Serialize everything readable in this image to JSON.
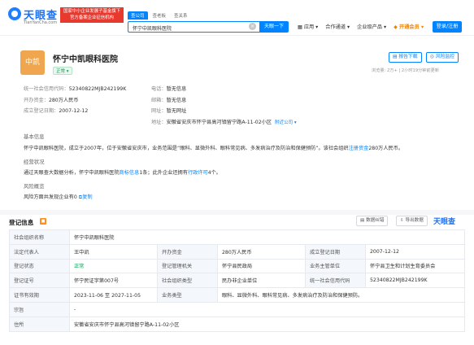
{
  "header": {
    "logo_cn": "天眼查",
    "logo_en": "TianYanCha.com",
    "promo_lines": [
      "国家中小企业发展子基金旗下",
      "官方备案企业征信机构"
    ],
    "search_tabs": [
      "查公司",
      "查老板",
      "查关系"
    ],
    "search_value": "怀宁中凯眼科医院",
    "search_button": "天眼一下",
    "nav": [
      "应用",
      "合作通道",
      "企业级产品",
      "开通会员"
    ],
    "login": "登录/注册"
  },
  "company": {
    "avatar": "中凯",
    "name": "怀宁中凯眼科医院",
    "status": "正常",
    "report_btn": "报告下载",
    "risk_btn": "风险监控",
    "meta": "浏览量: 2万+  |  2小时19分钟前更新",
    "fields_left": [
      {
        "k": "统一社会信用代码：",
        "v": "52340822MJB242199K"
      },
      {
        "k": "开办资金：",
        "v": "280万人民币"
      },
      {
        "k": "成立登记日期：",
        "v": "2007-12-12"
      }
    ],
    "fields_right": [
      {
        "k": "电话：",
        "v": "暂无信息"
      },
      {
        "k": "邮箱：",
        "v": "暂无信息"
      },
      {
        "k": "网址：",
        "v": "暂无网址"
      },
      {
        "k": "地址：",
        "v": "安徽省安庆市怀宁县高河镇留宁路A-11-02小区"
      }
    ],
    "address_tag": "附近公司",
    "basic_title": "基本信息",
    "basic_text_a": "怀宁中凯眼科医院，成立于2007年，位于安徽省安庆市，业务范围是“眼科、显微外科、眼科常见病、多发病治疗及防治和保健预防”。该社会组织",
    "basic_link": "注册资金",
    "basic_text_b": "280万人民币。",
    "ops_title": "经营状况",
    "ops_text_a": "通过天眼查大数据分析，怀宁中凯眼科医院",
    "ops_link_a": "商标信息",
    "ops_text_b": "1条；此外企业还拥有",
    "ops_link_b": "行政许可",
    "ops_text_c": "4个。",
    "risk_title": "风险概览",
    "risk_text": "风险方面共发现企业有0",
    "copy": "复制"
  },
  "registration": {
    "title": "登记信息",
    "badge": "■",
    "btn_correct": "数据纠错",
    "btn_export": "导出数据",
    "watermark": "天眼查",
    "rows": [
      [
        "社会组织名称",
        "怀宁中凯眼科医院",
        "",
        "",
        "",
        ""
      ],
      [
        "法定代表人",
        "王中凯",
        "开办资金",
        "280万人民币",
        "成立登记日期",
        "2007-12-12"
      ],
      [
        "登记状态",
        "正常",
        "登记管理机关",
        "怀宁县民政局",
        "业务主管单位",
        "怀宁县卫生和计划生育委员会"
      ],
      [
        "登记证号",
        "怀宁民证字第007号",
        "社会组织类型",
        "民办非企业单位",
        "统一社会信用代码",
        "52340822MJB242199K"
      ],
      [
        "证书有效期",
        "2023-11-06 至 2027-11-05",
        "业务类型",
        "眼科、显微外科、眼科常见病、多发病治疗及防治和保健预防。",
        "",
        ""
      ],
      [
        "宗旨",
        "-",
        "",
        "",
        "",
        ""
      ],
      [
        "住所",
        "安徽省安庆市怀宁县高河镇留宁路A-11-02小区",
        "",
        "",
        "",
        ""
      ]
    ]
  },
  "colors": {
    "accent": "#0084ff",
    "green": "#18a058",
    "orange": "#f08200"
  }
}
